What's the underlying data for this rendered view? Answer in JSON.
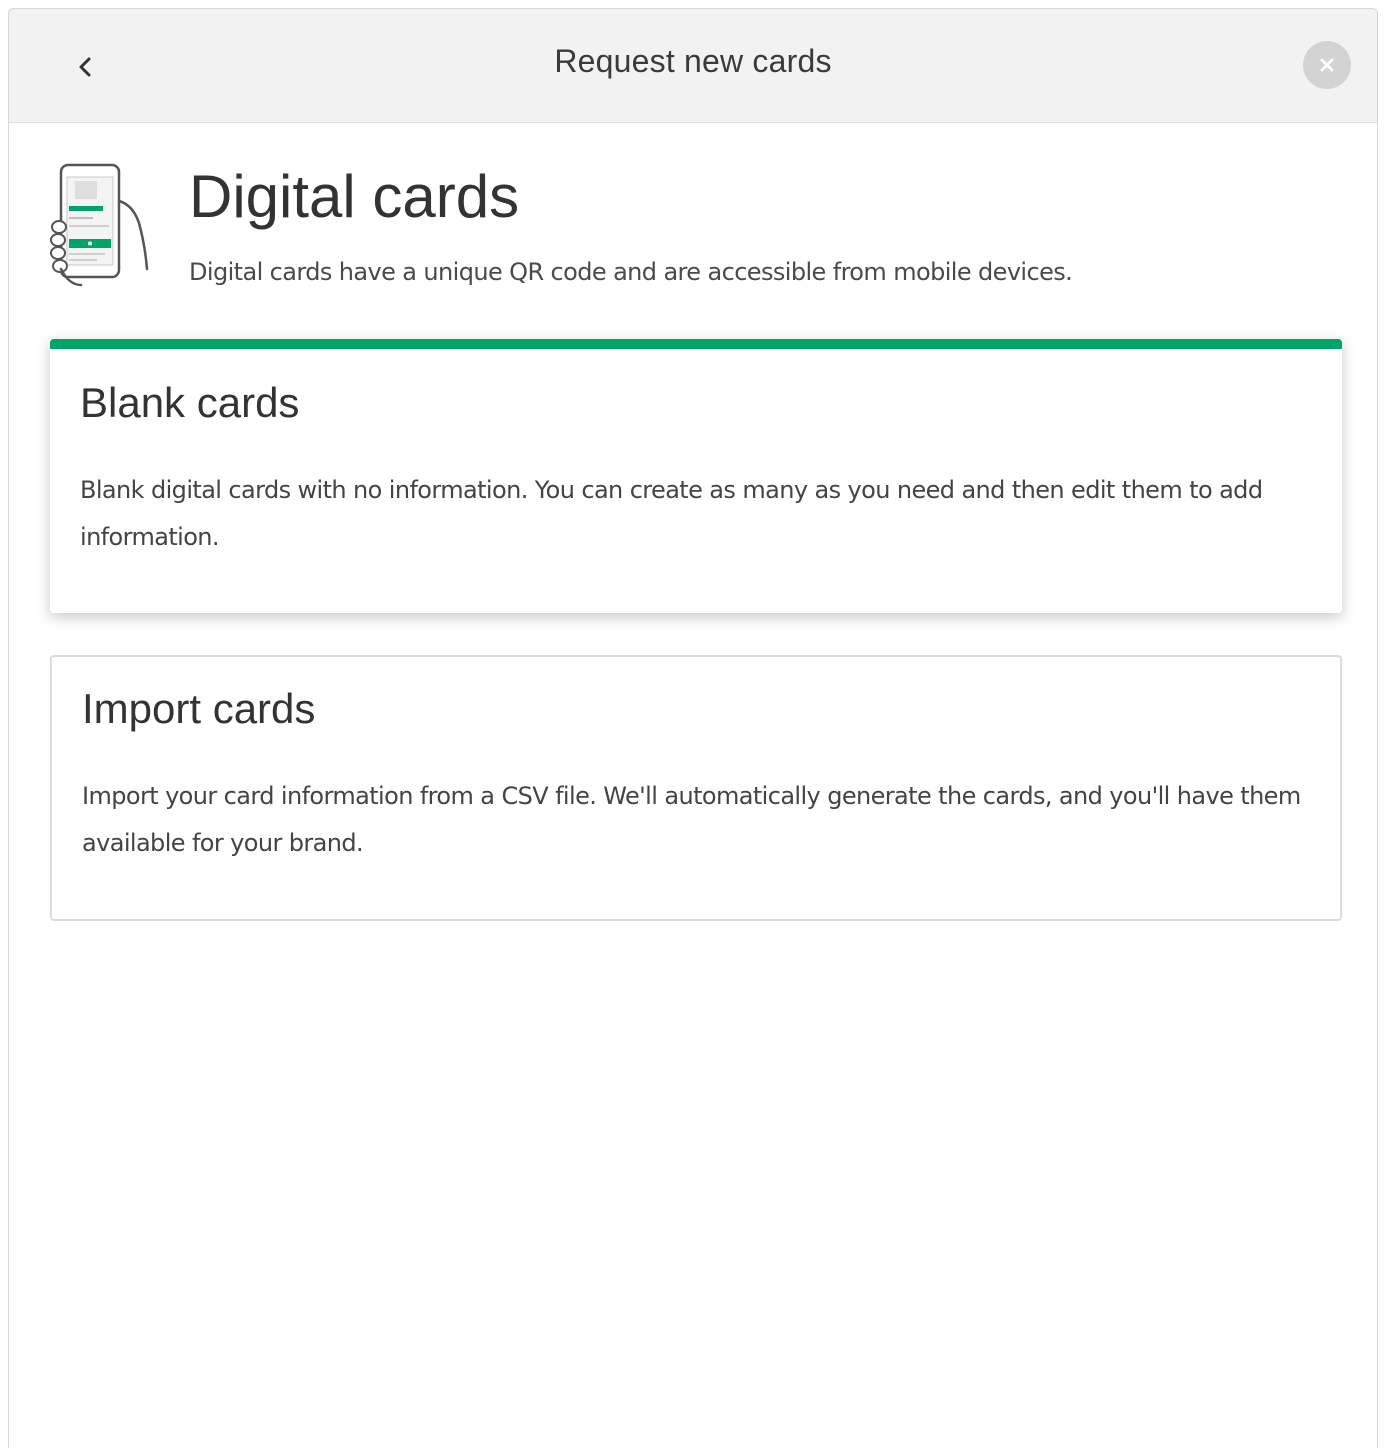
{
  "dialog": {
    "title": "Request new cards",
    "back_icon": "chevron-left-icon",
    "close_icon": "close-icon"
  },
  "intro": {
    "icon": "phone-in-hand-icon",
    "title": "Digital cards",
    "description": "Digital cards have a unique QR code and are accessible from mobile devices."
  },
  "options": [
    {
      "title": "Blank cards",
      "description": "Blank digital cards with no information. You can create as many as you need and then edit them to add information.",
      "selected": true
    },
    {
      "title": "Import cards",
      "description": "Import your card information from a CSV file. We'll automatically generate the cards, and you'll have them available for your brand.",
      "selected": false
    }
  ],
  "colors": {
    "accent": "#00a368",
    "header_bg": "#f2f2f2",
    "close_bg": "#d3d3d3",
    "text": "#333333"
  }
}
